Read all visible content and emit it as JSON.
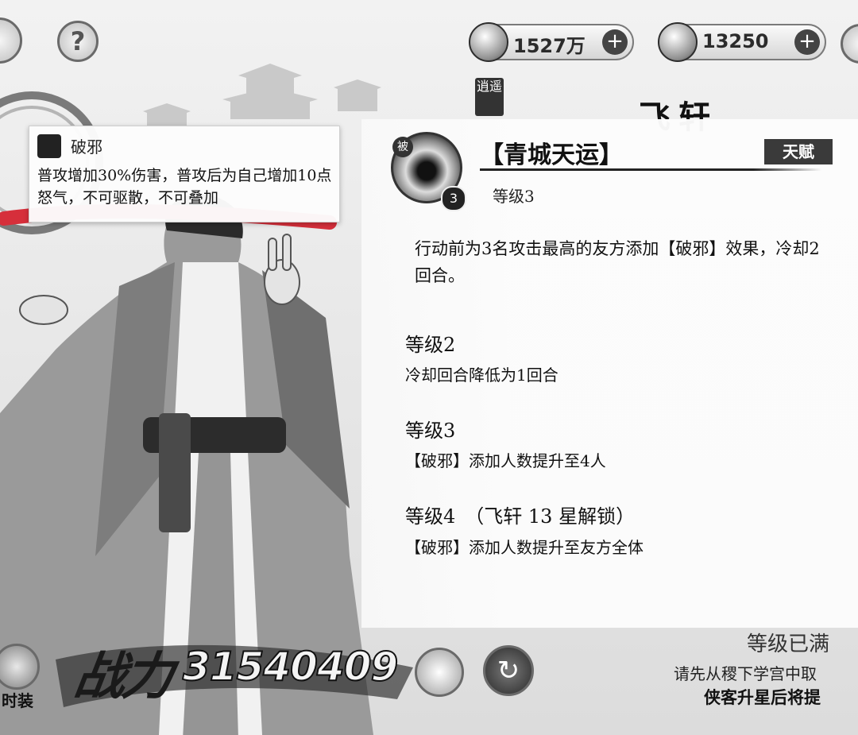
{
  "header": {
    "coins": {
      "value": "1527万",
      "add_label": "+"
    },
    "gems": {
      "value": "13250",
      "add_label": "+"
    },
    "help_label": "?",
    "vertical_tag": "逍遥",
    "hero_name": "飞轩"
  },
  "tooltip": {
    "title": "破邪",
    "description": "普攻增加30%伤害，普攻后为自己增加10点怒气，不可驱散，不可叠加"
  },
  "skill": {
    "tag": "被",
    "level_badge": "3",
    "name": "【青城天运】",
    "talent_label": "天赋",
    "level_text": "等级3",
    "description": "行动前为3名攻击最高的友方添加【破邪】效果，冷却2回合。"
  },
  "levels": [
    {
      "head": "等级2",
      "desc": "冷却回合降低为1回合"
    },
    {
      "head": "等级3",
      "desc": "【破邪】添加人数提升至4人"
    },
    {
      "head": "等级4　（飞轩 13 星解锁）",
      "desc": "【破邪】添加人数提升至友方全体"
    }
  ],
  "footer": {
    "max_label": "等级已满",
    "hint_line1": "请先从稷下学宫中取",
    "hint_line2": "侠客升星后将提",
    "power_label": "战力",
    "power_value": "31540409",
    "costume_label": "时装"
  }
}
